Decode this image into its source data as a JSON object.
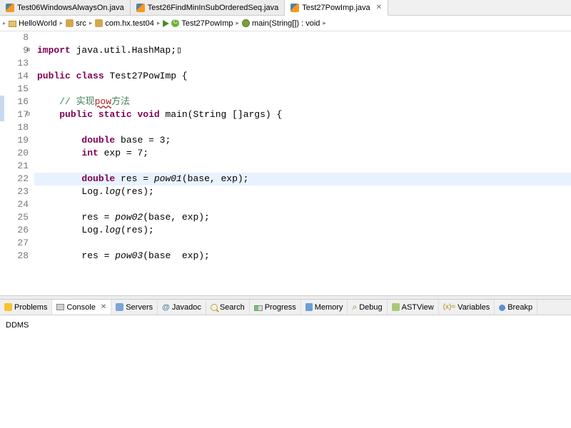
{
  "tabs": [
    {
      "label": "Test06WindowsAlwaysOn.java",
      "active": false
    },
    {
      "label": "Test26FindMinInSubOrderedSeq.java",
      "active": false
    },
    {
      "label": "Test27PowImp.java",
      "active": true
    }
  ],
  "breadcrumb": [
    {
      "label": "HelloWorld",
      "kind": "project"
    },
    {
      "label": "src",
      "kind": "folder"
    },
    {
      "label": "com.hx.test04",
      "kind": "package"
    },
    {
      "label": "Test27PowImp",
      "kind": "class"
    },
    {
      "label": "main(String[]) : void",
      "kind": "method"
    }
  ],
  "code_lines": [
    {
      "n": 8,
      "changed": false,
      "hl": false,
      "html": ""
    },
    {
      "n": 9,
      "changed": false,
      "hl": false,
      "fold": "+",
      "html": "<span class='kw'>import</span> java.util.HashMap;▯"
    },
    {
      "n": 13,
      "changed": false,
      "hl": false,
      "html": ""
    },
    {
      "n": 14,
      "changed": false,
      "hl": false,
      "html": "<span class='kw'>public</span> <span class='kw'>class</span> Test27PowImp {"
    },
    {
      "n": 15,
      "changed": false,
      "hl": false,
      "html": ""
    },
    {
      "n": 16,
      "changed": true,
      "hl": false,
      "html": "    <span class='cm'>// 实现<span class='sq'>pow</span>方法</span>"
    },
    {
      "n": 17,
      "changed": true,
      "hl": false,
      "fold": "-",
      "html": "    <span class='kw'>public</span> <span class='kw'>static</span> <span class='kw'>void</span> main(String []args) {"
    },
    {
      "n": 18,
      "changed": false,
      "hl": false,
      "html": ""
    },
    {
      "n": 19,
      "changed": false,
      "hl": false,
      "html": "        <span class='kw'>double</span> base = 3;"
    },
    {
      "n": 20,
      "changed": false,
      "hl": false,
      "html": "        <span class='kw'>int</span> exp = 7;"
    },
    {
      "n": 21,
      "changed": false,
      "hl": false,
      "html": ""
    },
    {
      "n": 22,
      "changed": false,
      "hl": true,
      "html": "        <span class='kw'>double</span> res = <span class='fn'>pow01</span>(base, exp);"
    },
    {
      "n": 23,
      "changed": false,
      "hl": false,
      "html": "        Log.<span class='fn'>log</span>(res);"
    },
    {
      "n": 24,
      "changed": false,
      "hl": false,
      "html": ""
    },
    {
      "n": 25,
      "changed": false,
      "hl": false,
      "html": "        res = <span class='fn'>pow02</span>(base, exp);"
    },
    {
      "n": 26,
      "changed": false,
      "hl": false,
      "html": "        Log.<span class='fn'>log</span>(res);"
    },
    {
      "n": 27,
      "changed": false,
      "hl": false,
      "html": ""
    },
    {
      "n": 28,
      "changed": false,
      "hl": false,
      "html": "        res = <span class='fn'>pow03</span>(base  exp);"
    }
  ],
  "bottom_tabs": [
    {
      "label": "Problems",
      "icon": "ic-prob",
      "active": false
    },
    {
      "label": "Console",
      "icon": "ic-cons",
      "active": true,
      "close": true
    },
    {
      "label": "Servers",
      "icon": "ic-serv",
      "active": false
    },
    {
      "label": "Javadoc",
      "icon": "ic-jdoc",
      "text_icon": "@",
      "active": false
    },
    {
      "label": "Search",
      "icon": "ic-search",
      "active": false
    },
    {
      "label": "Progress",
      "icon": "ic-prog",
      "active": false
    },
    {
      "label": "Memory",
      "icon": "ic-mem",
      "active": false
    },
    {
      "label": "Debug",
      "icon": "ic-bug",
      "text_icon": "⌕",
      "active": false
    },
    {
      "label": "ASTView",
      "icon": "ic-ast",
      "active": false
    },
    {
      "label": "Variables",
      "icon": "ic-var",
      "text_icon": "(x)=",
      "active": false
    },
    {
      "label": "Breakp",
      "icon": "ic-bp",
      "active": false
    }
  ],
  "console": {
    "text": "DDMS"
  }
}
